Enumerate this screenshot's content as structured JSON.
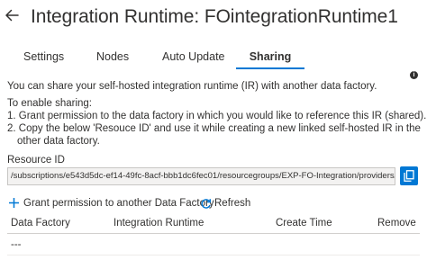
{
  "header": {
    "title": "Integration Runtime: FOintegrationRuntime1",
    "back_icon": "arrow-left-icon"
  },
  "tabs": [
    {
      "label": "Settings",
      "active": false
    },
    {
      "label": "Nodes",
      "active": false
    },
    {
      "label": "Auto Update",
      "active": false
    },
    {
      "label": "Sharing",
      "active": true
    }
  ],
  "accent_color": "#0078d4",
  "description": {
    "line1": "You can share your self-hosted integration runtime (IR) with another data factory.",
    "line2": "To enable sharing:",
    "line3": "1. Grant permission to the data factory in which you would like to reference this IR (shared).",
    "line4a": "2. Copy the below 'Resouce ID' and use it while creating a new linked self-hosted IR in the",
    "line4b": "other data factory."
  },
  "resource_id": {
    "label": "Resource ID",
    "info_icon": "info-icon",
    "value": "/subscriptions/e543d5dc-ef14-49fc-8acf-bbb1dc6fec01/resourcegroups/EXP-FO-Integration/providers/",
    "copy_icon": "copy-icon"
  },
  "toolbar": {
    "grant_label": "Grant permission to another Data Factory",
    "refresh_label": "Refresh"
  },
  "table": {
    "columns": [
      "Data Factory",
      "Integration Runtime",
      "Create Time",
      "Remove"
    ],
    "rows": [
      [
        "---"
      ]
    ]
  }
}
